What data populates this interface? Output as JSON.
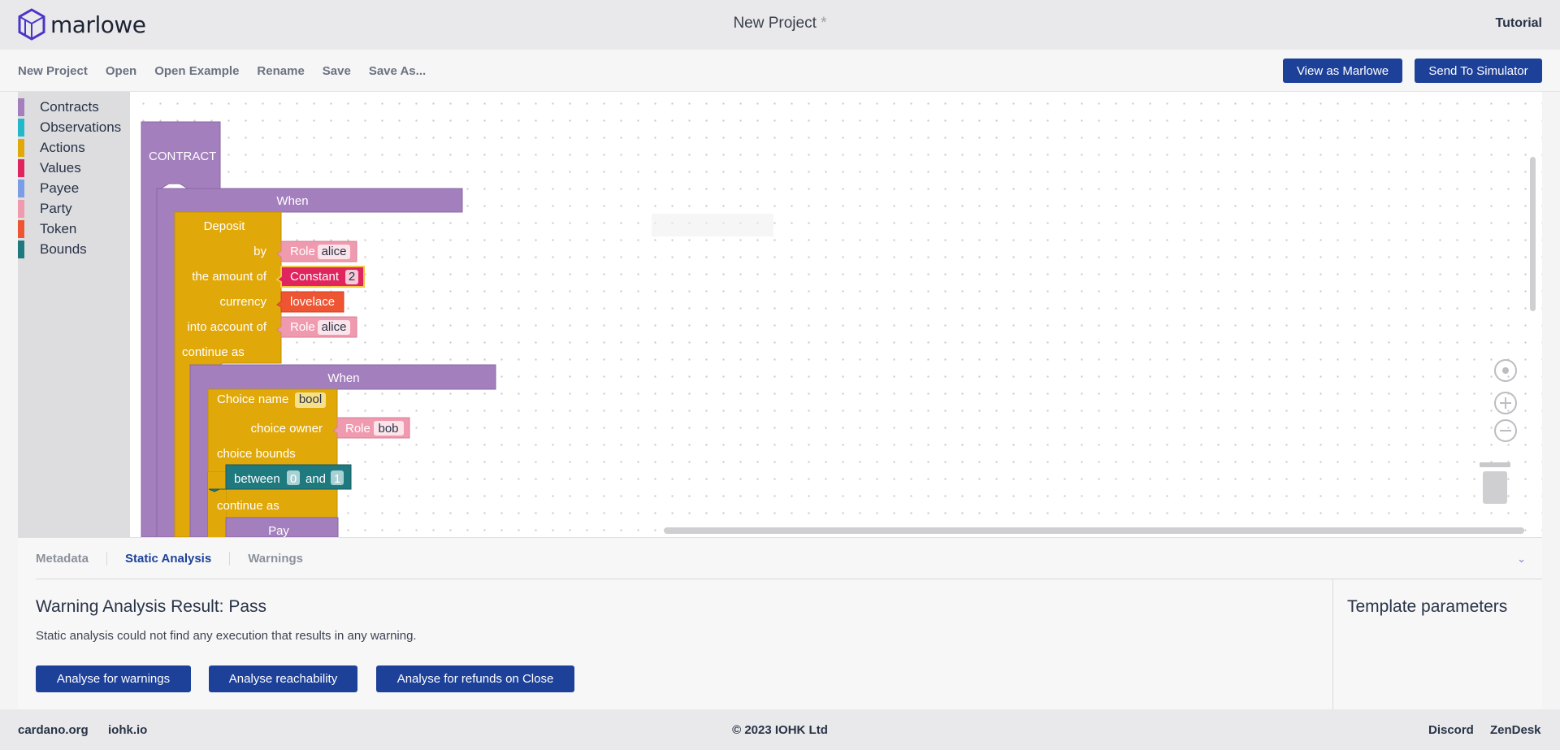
{
  "app": {
    "name": "marlowe",
    "project_title": "New Project",
    "unsaved_marker": "*",
    "tutorial": "Tutorial"
  },
  "menu": {
    "items": [
      "New Project",
      "Open",
      "Open Example",
      "Rename",
      "Save",
      "Save As..."
    ],
    "view_as_marlowe": "View as Marlowe",
    "send_to_simulator": "Send To Simulator"
  },
  "toolbox": {
    "categories": [
      {
        "label": "Contracts",
        "color": "#a47fbd"
      },
      {
        "label": "Observations",
        "color": "#22b8c8"
      },
      {
        "label": "Actions",
        "color": "#e1a80a"
      },
      {
        "label": "Values",
        "color": "#e0245e"
      },
      {
        "label": "Payee",
        "color": "#7a9de6"
      },
      {
        "label": "Party",
        "color": "#f09ab0"
      },
      {
        "label": "Token",
        "color": "#ee5532"
      },
      {
        "label": "Bounds",
        "color": "#1f7a80"
      }
    ]
  },
  "blocks": {
    "contract": "CONTRACT",
    "when": "When",
    "deposit": {
      "title": "Deposit",
      "by": "by",
      "amount": "the amount of",
      "currency": "currency",
      "into": "into account of",
      "continue": "continue as"
    },
    "role": "Role",
    "alice": "alice",
    "bob": "bob",
    "constant": "Constant",
    "constant_value": "2",
    "lovelace": "lovelace",
    "choice": {
      "name_label": "Choice name",
      "name": "bool",
      "owner": "choice owner",
      "bounds": "choice bounds",
      "continue": "continue as"
    },
    "between": {
      "label": "between",
      "low": "0",
      "and": "and",
      "high": "1"
    },
    "pay": "Pay"
  },
  "panel": {
    "tabs": [
      "Metadata",
      "Static Analysis",
      "Warnings"
    ],
    "active_tab": "Static Analysis",
    "result_title": "Warning Analysis Result: Pass",
    "result_desc": "Static analysis could not find any execution that results in any warning.",
    "buttons": [
      "Analyse for warnings",
      "Analyse reachability",
      "Analyse for refunds on Close"
    ],
    "template_title": "Template parameters"
  },
  "footer": {
    "left": [
      "cardano.org",
      "iohk.io"
    ],
    "copyright": "© 2023 IOHK Ltd",
    "right": [
      "Discord",
      "ZenDesk"
    ]
  }
}
